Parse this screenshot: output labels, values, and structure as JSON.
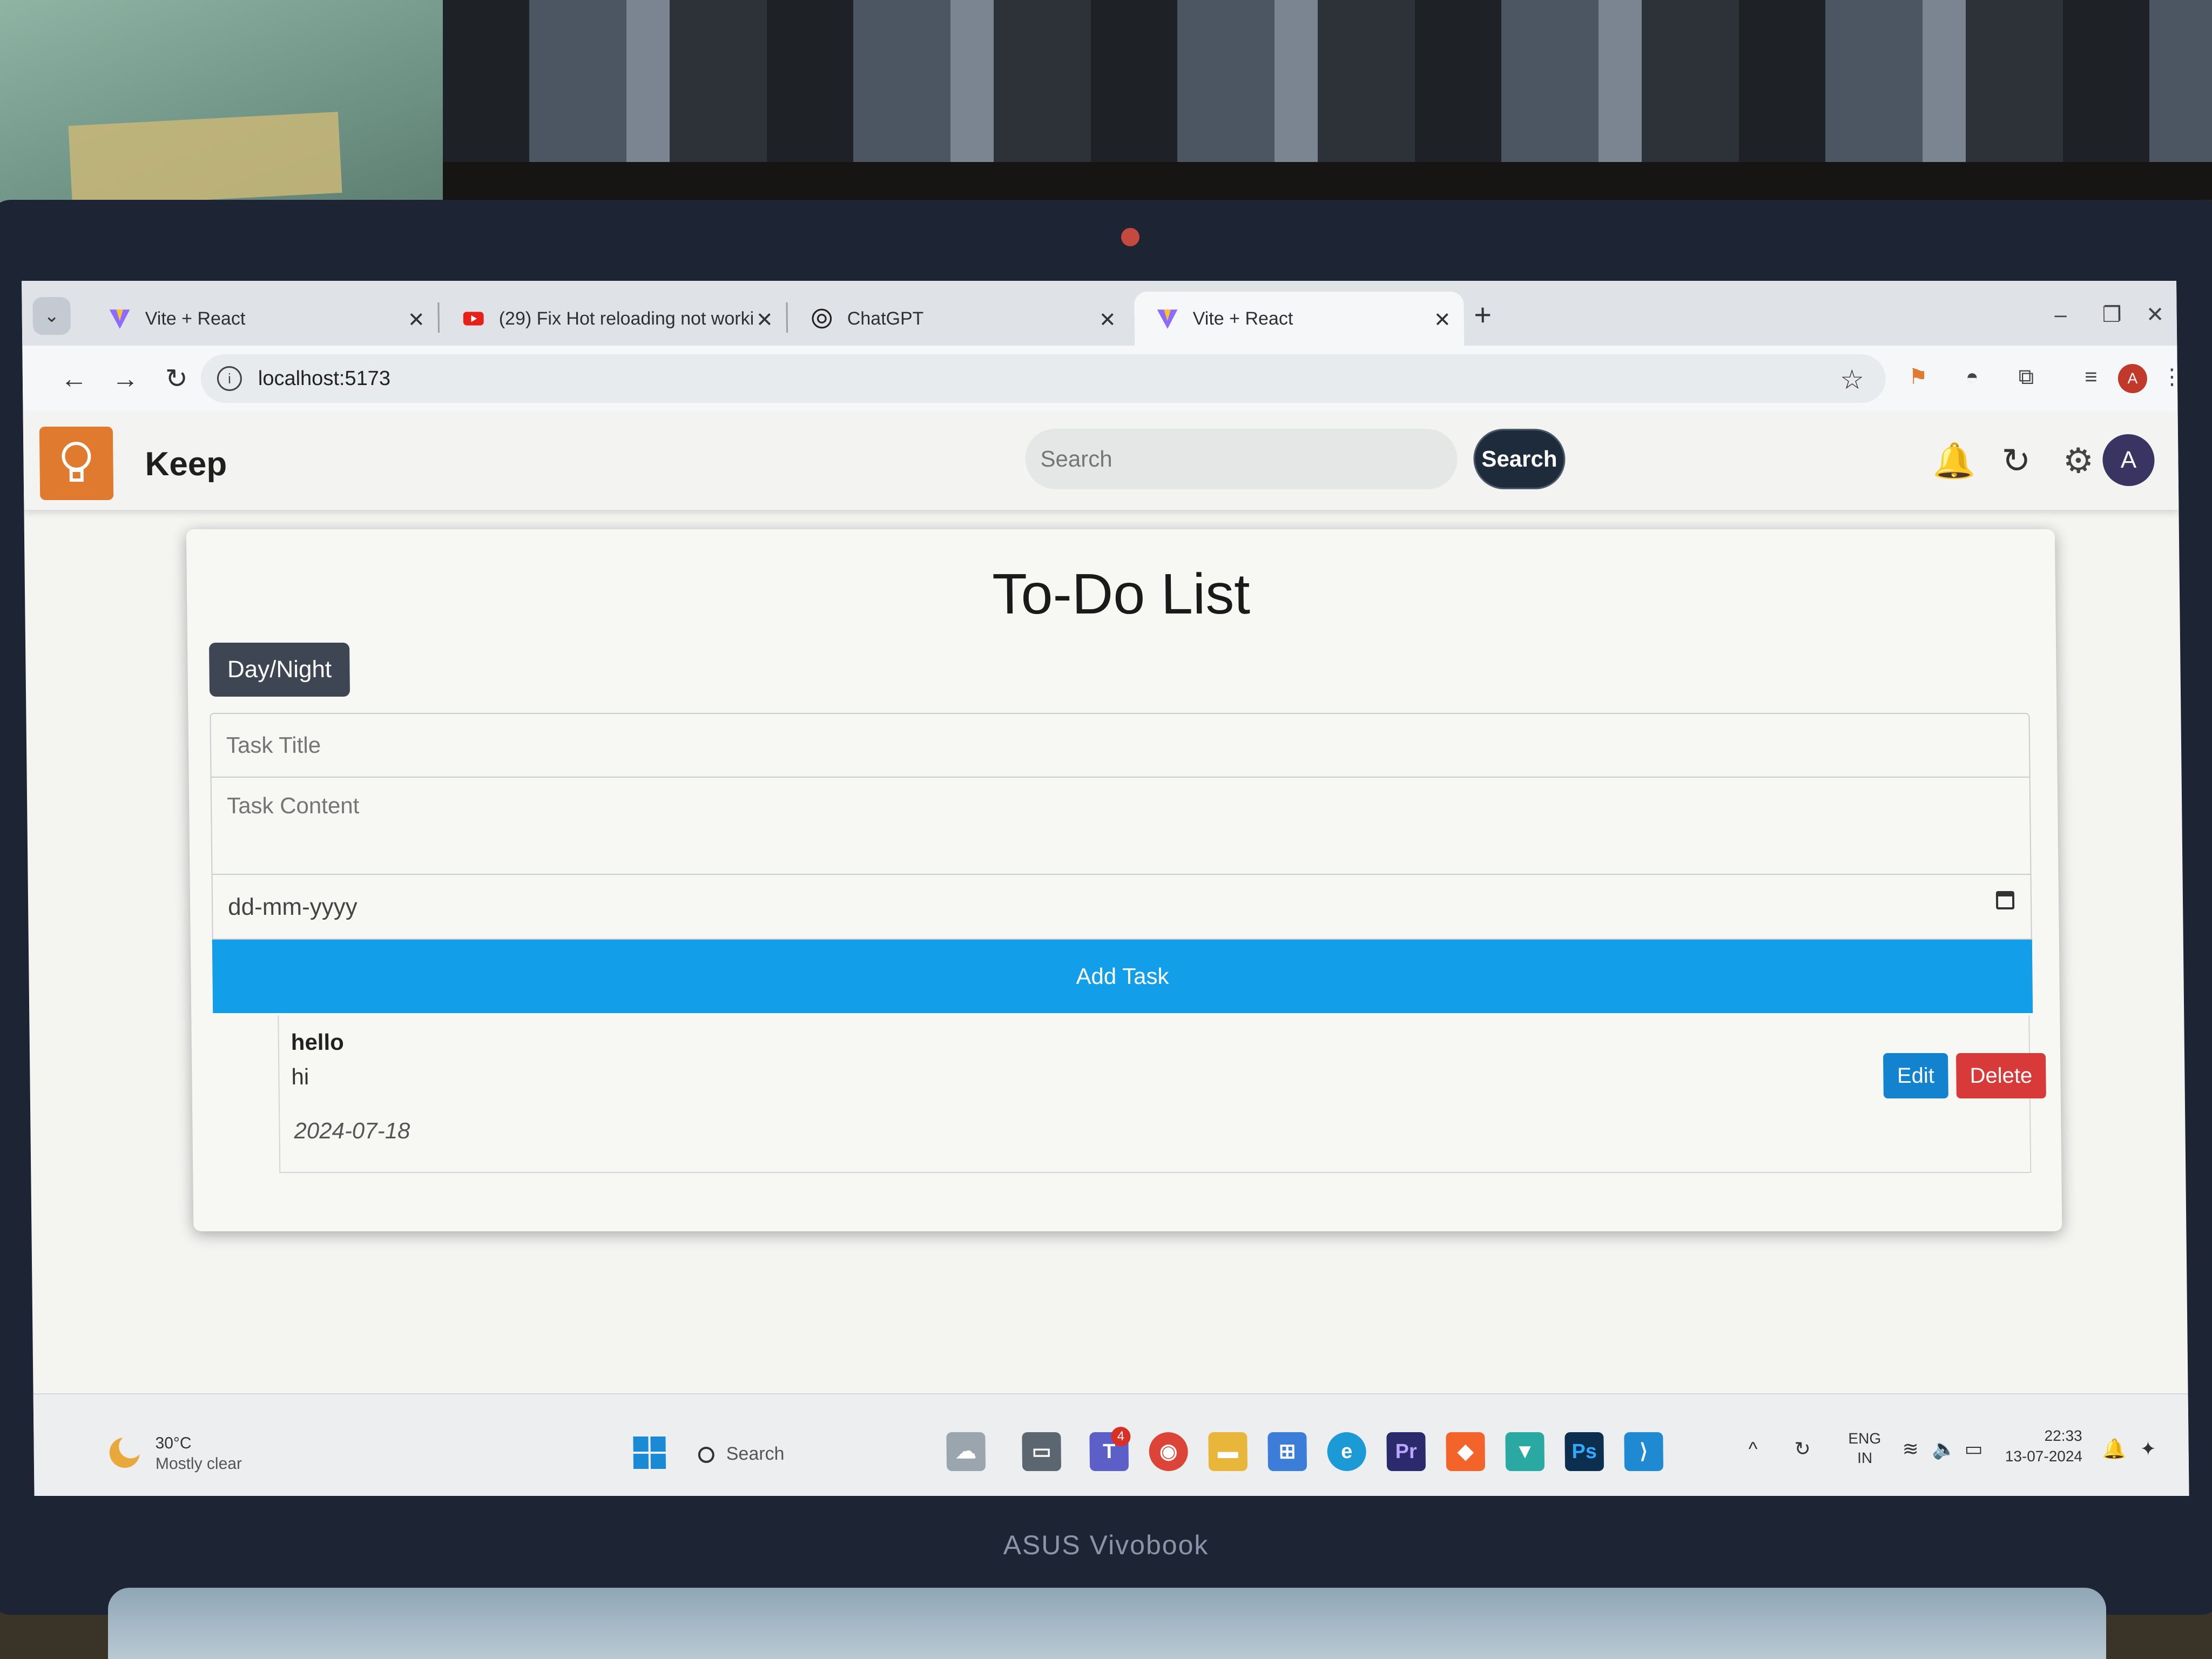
{
  "device": {
    "brand": "ASUS Vivobook"
  },
  "browser": {
    "tabs": [
      {
        "label": "Vite + React",
        "icon": "vite-icon",
        "active": false
      },
      {
        "label": "(29) Fix Hot reloading not worki",
        "icon": "youtube-icon",
        "active": false
      },
      {
        "label": "ChatGPT",
        "icon": "chatgpt-icon",
        "active": false
      },
      {
        "label": "Vite + React",
        "icon": "vite-icon",
        "active": true
      }
    ],
    "close_glyph": "✕",
    "new_tab_glyph": "+",
    "url": "localhost:5173",
    "profile_initial": "A"
  },
  "app": {
    "title": "Keep",
    "search": {
      "placeholder": "Search",
      "button_label": "Search"
    },
    "avatar_initial": "A",
    "accent_color": "#e07a2e"
  },
  "todo": {
    "title": "To-Do List",
    "theme_toggle_label": "Day/Night",
    "task_title_placeholder": "Task Title",
    "task_content_placeholder": "Task Content",
    "date_placeholder": "dd-mm-yyyy",
    "add_button_label": "Add Task",
    "add_button_color": "#129ee8",
    "tasks": [
      {
        "title": "hello",
        "content": "hi",
        "date": "2024-07-18",
        "edit_label": "Edit",
        "delete_label": "Delete"
      }
    ]
  },
  "taskbar": {
    "weather_temp": "30°C",
    "weather_desc": "Mostly clear",
    "search_label": "Search",
    "notification_badge": "4",
    "tray_lang_line1": "ENG",
    "tray_lang_line2": "IN",
    "time": "22:33",
    "date": "13-07-2024"
  }
}
